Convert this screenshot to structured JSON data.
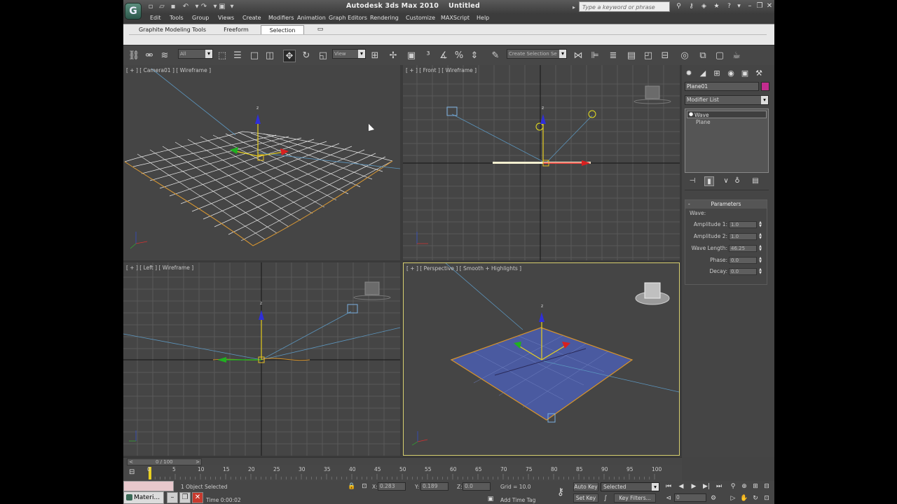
{
  "app": {
    "title": "Autodesk 3ds Max  2010",
    "document": "Untitled",
    "search_placeholder": "Type a keyword or phrase"
  },
  "quick_access": [
    "new-icon",
    "open-icon",
    "save-icon",
    "undo-icon",
    "redo-icon",
    "project-folder-icon"
  ],
  "menu": [
    "Edit",
    "Tools",
    "Group",
    "Views",
    "Create",
    "Modifiers",
    "Animation",
    "Graph Editors",
    "Rendering",
    "Customize",
    "MAXScript",
    "Help"
  ],
  "ribbon": {
    "tabs": [
      "Graphite Modeling Tools",
      "Freeform",
      "Selection"
    ],
    "selected": "Selection"
  },
  "toolbar": {
    "filter": "All",
    "ref_coord": "View",
    "named_selection": "Create Selection Se"
  },
  "viewports": {
    "camera": "[ + ] [ Camera01 ] [ Wireframe ]",
    "front": "[ + ] [ Front ] [ Wireframe ]",
    "left": "[ + ] [ Left ] [ Wireframe ]",
    "perspective": "[ + ] [ Perspective ] [ Smooth + Highlights ]"
  },
  "command_panel": {
    "object_name": "Plane01",
    "object_color": "#c32d8f",
    "modifier_list": "Modifier List",
    "stack": [
      "Wave",
      "Plane"
    ],
    "rollout_title": "Parameters",
    "group_label": "Wave:",
    "params": [
      {
        "label": "Amplitude 1:",
        "value": "1.0"
      },
      {
        "label": "Amplitude 2:",
        "value": "1.0"
      },
      {
        "label": "Wave Length:",
        "value": "46.25"
      },
      {
        "label": "Phase:",
        "value": "0.0"
      },
      {
        "label": "Decay:",
        "value": "0.0"
      }
    ]
  },
  "timeline": {
    "slider": "0 / 100",
    "ticks": [
      "0",
      "5",
      "10",
      "15",
      "20",
      "25",
      "30",
      "35",
      "40",
      "45",
      "50",
      "55",
      "60",
      "65",
      "70",
      "75",
      "80",
      "85",
      "90",
      "95",
      "100"
    ]
  },
  "status": {
    "selection": "1 Object Selected",
    "time": "Time  0:00:02",
    "x_label": "X:",
    "x_value": "0.283",
    "y_label": "Y:",
    "y_value": "0.189",
    "z_label": "Z:",
    "z_value": "0.0",
    "grid": "Grid = 10.0",
    "add_time_tag": "Add Time Tag",
    "auto_key": "Auto Key",
    "set_key": "Set Key",
    "key_mode": "Selected",
    "key_filters": "Key Filters...",
    "frame": "0"
  },
  "taskbar": {
    "app_label": "Materi..."
  }
}
